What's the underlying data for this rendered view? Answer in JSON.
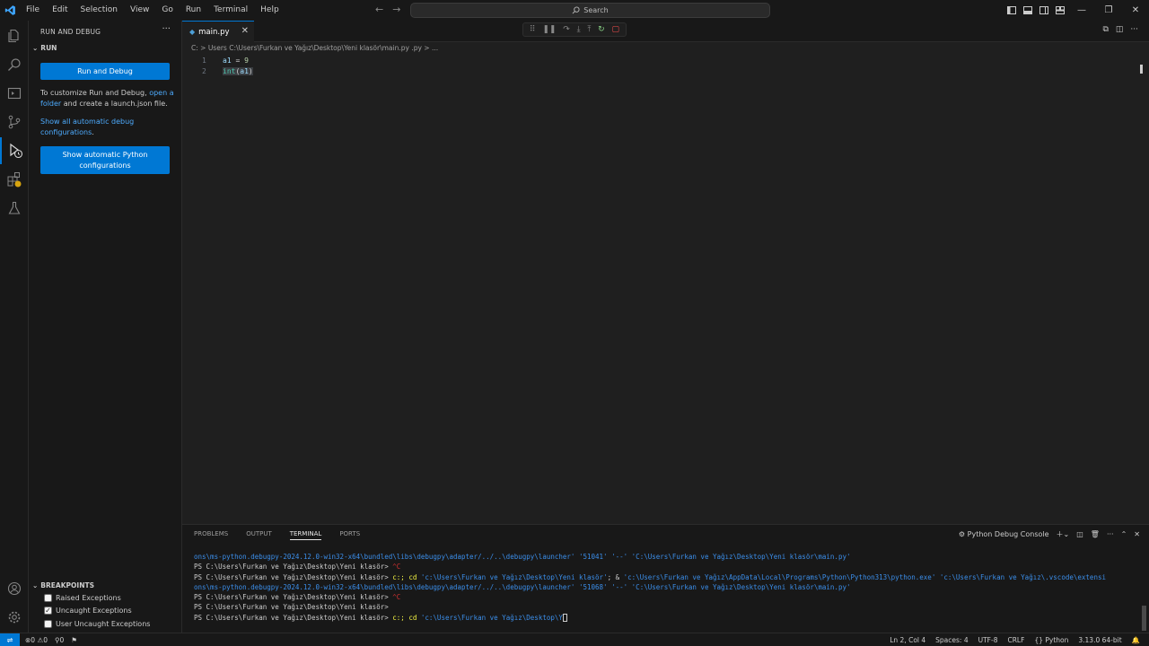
{
  "menu": [
    "File",
    "Edit",
    "Selection",
    "View",
    "Go",
    "Run",
    "Terminal",
    "Help"
  ],
  "search": {
    "label": "Search"
  },
  "sidebar": {
    "header": "RUN AND DEBUG",
    "section": "RUN",
    "run_button": "Run and Debug",
    "text1_a": "To customize Run and Debug, ",
    "text1_link": "open a folder",
    "text1_b": " and create a launch.json file.",
    "link2": "Show all automatic debug configurations",
    "link2_tail": ".",
    "python_button": "Show automatic Python configurations",
    "breakpoints": {
      "header": "BREAKPOINTS",
      "items": [
        {
          "label": "Raised Exceptions",
          "checked": false
        },
        {
          "label": "Uncaught Exceptions",
          "checked": true
        },
        {
          "label": "User Uncaught Exceptions",
          "checked": false
        }
      ]
    }
  },
  "tab": {
    "name": "main.py"
  },
  "breadcrumb": "C: > Users   C:\\Users\\Furkan ve Yağız\\Desktop\\Yeni klasör\\main.py  .py > ...",
  "editor": {
    "lines": [
      {
        "num": "1",
        "var": "a1",
        "op": " = ",
        "value": "9"
      },
      {
        "num": "2",
        "fn": "int",
        "arg": "a1"
      }
    ]
  },
  "panel": {
    "tabs": [
      "PROBLEMS",
      "OUTPUT",
      "TERMINAL",
      "PORTS"
    ],
    "active_tab": "TERMINAL",
    "terminal_name": "Python Debug Console",
    "terminal": {
      "l1": "ons\\ms-python.debugpy-2024.12.0-win32-x64\\bundled\\libs\\debugpy\\adapter/../..\\debugpy\\launcher' '51041' '--' 'C:\\Users\\Furkan ve Yağız\\Desktop\\Yeni klasör\\main.py'",
      "prompt": "PS C:\\Users\\Furkan ve Yağız\\Desktop\\Yeni klasör> ",
      "ctrlc": "^C",
      "cmd_a": "c:; cd ",
      "cmd_b": "'c:\\Users\\Furkan ve Yağız\\Desktop\\Yeni klasör'",
      "cmd_c": "; & ",
      "cmd_d": "'c:\\Users\\Furkan ve Yağız\\AppData\\Local\\Programs\\Python\\Python313\\python.exe' 'c:\\Users\\Furkan ve Yağız\\.vscode\\extensi",
      "l4": "ons\\ms-python.debugpy-2024.12.0-win32-x64\\bundled\\libs\\debugpy\\adapter/../..\\debugpy\\launcher' '51068' '--' 'C:\\Users\\Furkan ve Yağız\\Desktop\\Yeni klasör\\main.py'",
      "last_b": "'c:\\Users\\Furkan ve Yağız\\Desktop\\Y"
    }
  },
  "status": {
    "errors": "0",
    "warnings": "0",
    "ports": "0",
    "position": "Ln 2, Col 4",
    "spaces": "Spaces: 4",
    "encoding": "UTF-8",
    "eol": "CRLF",
    "language": "Python",
    "interpreter": "3.13.0 64-bit"
  },
  "colors": {
    "accent": "#0078d4",
    "link": "#4daafc"
  }
}
